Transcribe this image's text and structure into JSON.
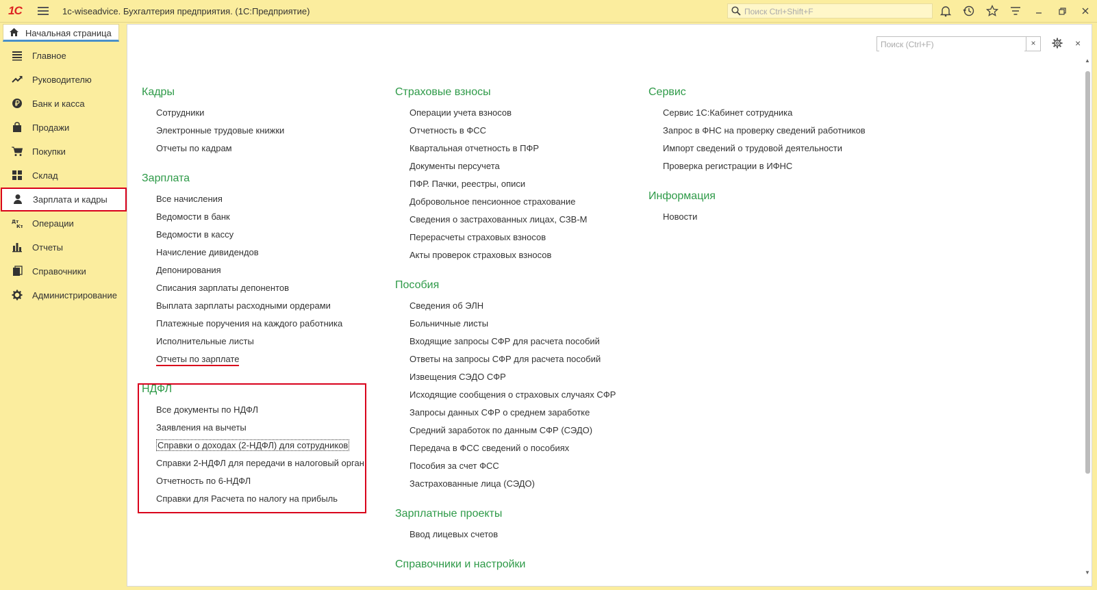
{
  "titlebar": {
    "logo": "1С",
    "app_title": "1c-wiseadvice. Бухгалтерия предприятия.  (1С:Предприятие)",
    "search_placeholder": "Поиск Ctrl+Shift+F"
  },
  "home_tab": {
    "label": "Начальная страница"
  },
  "sidebar": {
    "items": [
      {
        "label": "Главное",
        "icon": "list-icon"
      },
      {
        "label": "Руководителю",
        "icon": "trend-icon"
      },
      {
        "label": "Банк и касса",
        "icon": "coin-icon"
      },
      {
        "label": "Продажи",
        "icon": "bag-icon"
      },
      {
        "label": "Покупки",
        "icon": "cart-icon"
      },
      {
        "label": "Склад",
        "icon": "grid-icon"
      },
      {
        "label": "Зарплата и кадры",
        "icon": "person-icon",
        "active": true
      },
      {
        "label": "Операции",
        "icon": "dtkt-icon"
      },
      {
        "label": "Отчеты",
        "icon": "bar-chart-icon"
      },
      {
        "label": "Справочники",
        "icon": "book-icon"
      },
      {
        "label": "Администрирование",
        "icon": "gear-icon"
      }
    ]
  },
  "panel": {
    "search_placeholder": "Поиск (Ctrl+F)",
    "clear_label": "×",
    "close_label": "×"
  },
  "columns": {
    "col1": [
      {
        "title": "Кадры",
        "links": [
          "Сотрудники",
          "Электронные трудовые книжки",
          "Отчеты по кадрам"
        ]
      },
      {
        "title": "Зарплата",
        "links": [
          "Все начисления",
          "Ведомости в банк",
          "Ведомости в кассу",
          "Начисление дивидендов",
          "Депонирования",
          "Списания зарплаты депонентов",
          "Выплата зарплаты расходными ордерами",
          "Платежные поручения на каждого работника",
          "Исполнительные листы",
          "Отчеты по зарплате"
        ]
      },
      {
        "title": "НДФЛ",
        "links": [
          "Все документы по НДФЛ",
          "Заявления на вычеты",
          "Справки о доходах (2-НДФЛ) для сотрудников",
          "Справки 2-НДФЛ для передачи в налоговый орган",
          "Отчетность по 6-НДФЛ",
          "Справки для Расчета по налогу на прибыль"
        ]
      }
    ],
    "col2": [
      {
        "title": "Страховые взносы",
        "links": [
          "Операции учета взносов",
          "Отчетность в ФСС",
          "Квартальная отчетность в ПФР",
          "Документы персучета",
          "ПФР. Пачки, реестры, описи",
          "Добровольное пенсионное страхование",
          "Сведения о застрахованных лицах, СЗВ-М",
          "Перерасчеты страховых взносов",
          "Акты проверок страховых взносов"
        ]
      },
      {
        "title": "Пособия",
        "links": [
          "Сведения об ЭЛН",
          "Больничные листы",
          "Входящие запросы СФР для расчета пособий",
          "Ответы на запросы СФР для расчета пособий",
          "Извещения СЭДО СФР",
          "Исходящие сообщения о страховых случаях СФР",
          "Запросы данных СФР о среднем заработке",
          "Средний заработок по данным СФР (СЭДО)",
          "Передача в ФСС сведений о пособиях",
          "Пособия за счет ФСС",
          "Застрахованные лица (СЭДО)"
        ]
      },
      {
        "title": "Зарплатные проекты",
        "links": [
          "Ввод лицевых счетов"
        ]
      },
      {
        "title": "Справочники и настройки",
        "links": []
      }
    ],
    "col3": [
      {
        "title": "Сервис",
        "links": [
          "Сервис 1С:Кабинет сотрудника",
          "Запрос в ФНС на проверку сведений работников",
          "Импорт сведений о трудовой деятельности",
          "Проверка регистрации в ИФНС"
        ]
      },
      {
        "title": "Информация",
        "links": [
          "Новости"
        ]
      }
    ]
  },
  "colors": {
    "sidebar_bg": "#fbed9e",
    "section_title": "#2e9a48",
    "highlight": "#d9001b",
    "tab_accent": "#4a90c9"
  }
}
